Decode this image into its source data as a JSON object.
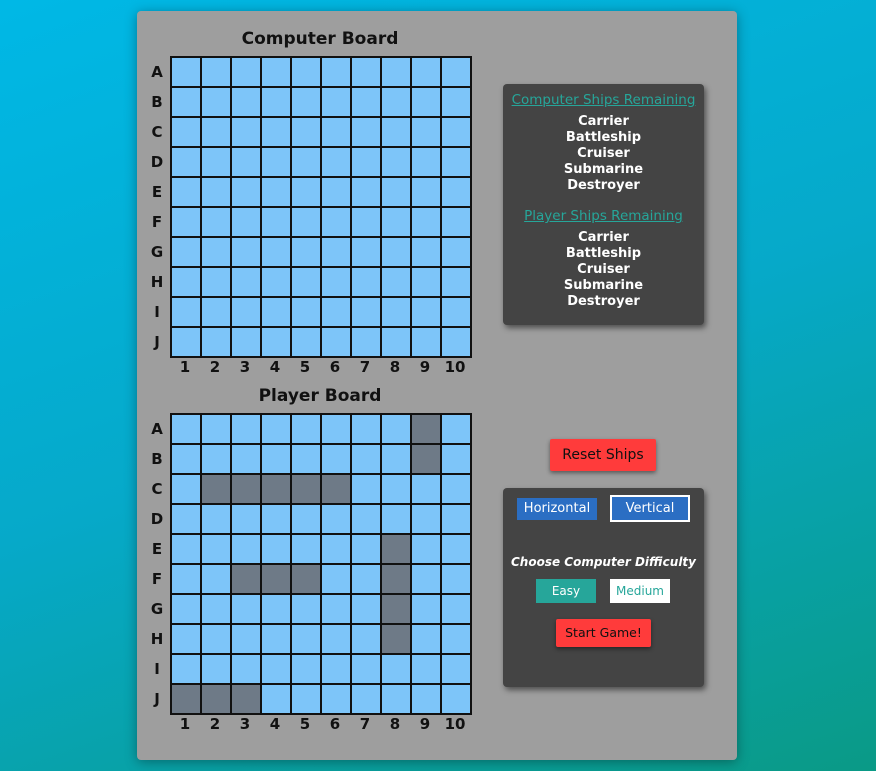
{
  "computer_board": {
    "title": "Computer Board",
    "row_labels": [
      "A",
      "B",
      "C",
      "D",
      "E",
      "F",
      "G",
      "H",
      "I",
      "J"
    ],
    "col_labels": [
      "1",
      "2",
      "3",
      "4",
      "5",
      "6",
      "7",
      "8",
      "9",
      "10"
    ],
    "ship_cells": []
  },
  "player_board": {
    "title": "Player Board",
    "row_labels": [
      "A",
      "B",
      "C",
      "D",
      "E",
      "F",
      "G",
      "H",
      "I",
      "J"
    ],
    "col_labels": [
      "1",
      "2",
      "3",
      "4",
      "5",
      "6",
      "7",
      "8",
      "9",
      "10"
    ],
    "ship_cells": [
      "A9",
      "B9",
      "C2",
      "C3",
      "C4",
      "C5",
      "C6",
      "E8",
      "F3",
      "F4",
      "F5",
      "F8",
      "G8",
      "H8",
      "J1",
      "J2",
      "J3"
    ]
  },
  "status": {
    "computer_title": "Computer Ships Remaining",
    "computer_ships": [
      "Carrier",
      "Battleship",
      "Cruiser",
      "Submarine",
      "Destroyer"
    ],
    "player_title": "Player Ships Remaining",
    "player_ships": [
      "Carrier",
      "Battleship",
      "Cruiser",
      "Submarine",
      "Destroyer"
    ]
  },
  "controls": {
    "reset_label": "Reset Ships",
    "horizontal_label": "Horizontal",
    "vertical_label": "Vertical",
    "difficulty_title": "Choose Computer Difficulty",
    "easy_label": "Easy",
    "medium_label": "Medium",
    "start_label": "Start Game!"
  },
  "colors": {
    "water": "#7dc5f9",
    "ship": "#6e7a87",
    "accent_teal": "#26a69a",
    "button_red": "#ff3b3b",
    "button_blue": "#2b6ec3"
  }
}
